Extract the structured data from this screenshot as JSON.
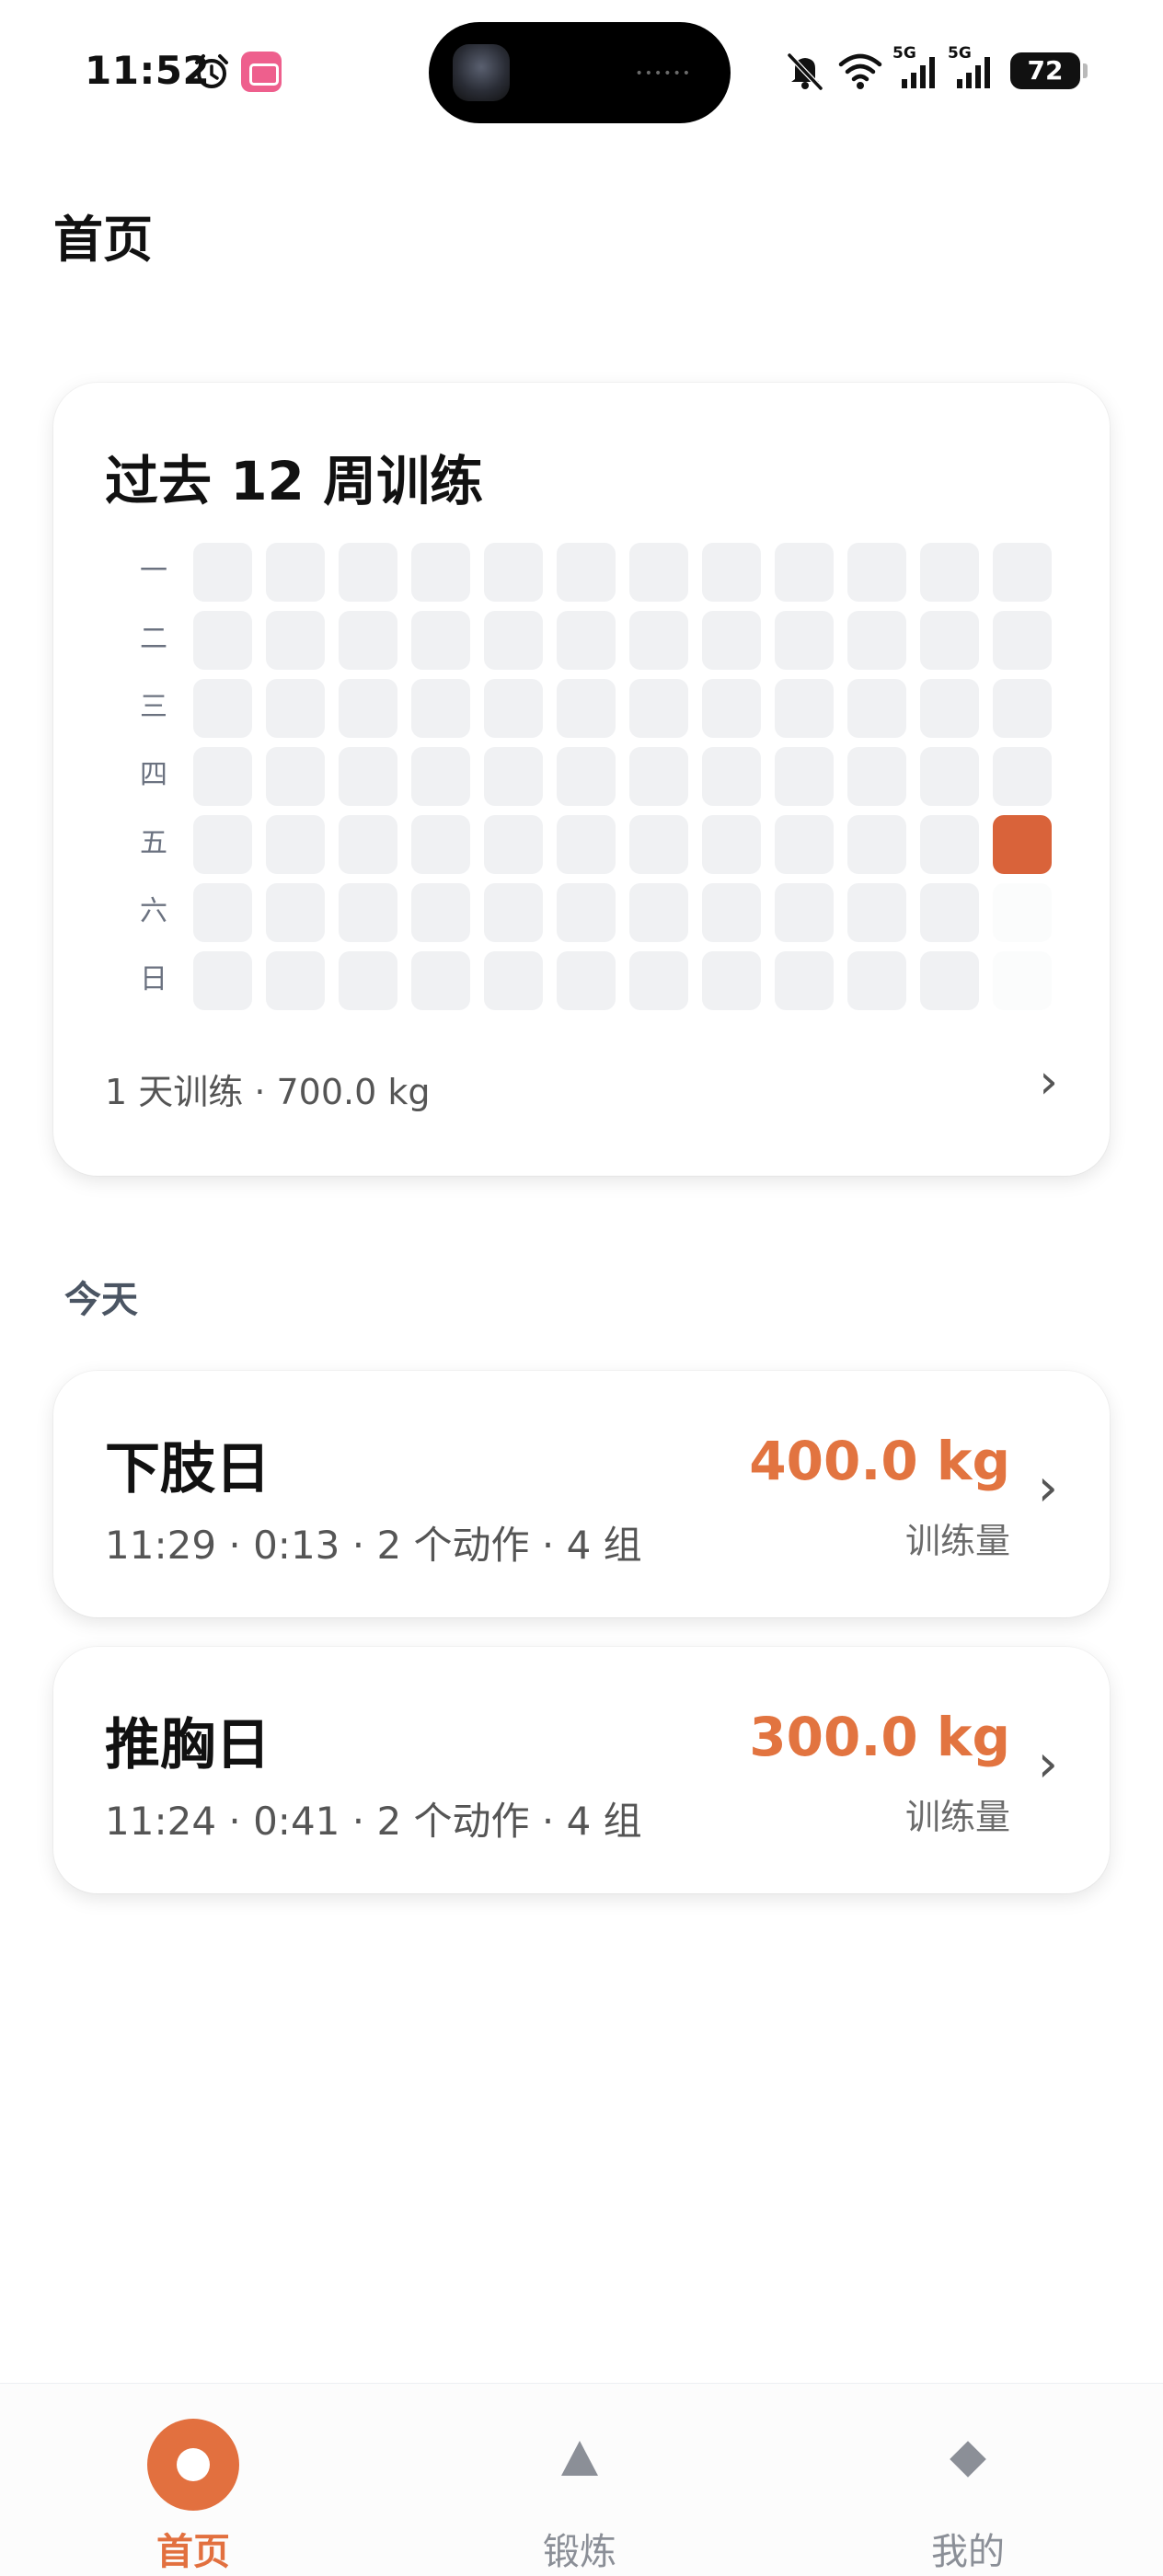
{
  "status_bar": {
    "time": "11:52",
    "battery": "72",
    "network_1": "5G",
    "network_2": "5G",
    "icons": [
      "alarm-icon",
      "bilibili-app-icon",
      "mute-icon",
      "wifi-icon",
      "signal-icon",
      "signal-icon",
      "battery-icon"
    ]
  },
  "page": {
    "title": "首页"
  },
  "heatmap": {
    "title": "过去 12 周训练",
    "day_labels": [
      "一",
      "二",
      "三",
      "四",
      "五",
      "六",
      "日"
    ],
    "weeks": 12,
    "active_cells": [
      {
        "week": 12,
        "day": "五"
      }
    ],
    "future_cells": [
      {
        "week": 12,
        "day": "六"
      },
      {
        "week": 12,
        "day": "日"
      }
    ],
    "active_color": "#d9633a",
    "empty_color": "#f0f1f3",
    "summary": "1 天训练 · 700.0 kg"
  },
  "today": {
    "label": "今天",
    "workouts": [
      {
        "name": "下肢日",
        "meta": "11:29 · 0:13 · 2 个动作 · 4 组",
        "volume": "400.0 kg",
        "volume_label": "训练量"
      },
      {
        "name": "推胸日",
        "meta": "11:24 · 0:41 · 2 个动作 · 4 组",
        "volume": "300.0 kg",
        "volume_label": "训练量"
      }
    ]
  },
  "bottom_nav": {
    "items": [
      {
        "label": "首页",
        "icon": "home-circle-icon",
        "active": true
      },
      {
        "label": "锻炼",
        "icon": "triangle-icon",
        "active": false
      },
      {
        "label": "我的",
        "icon": "diamond-icon",
        "active": false
      }
    ]
  },
  "colors": {
    "accent": "#e2703f",
    "volume_text": "#e27440"
  }
}
